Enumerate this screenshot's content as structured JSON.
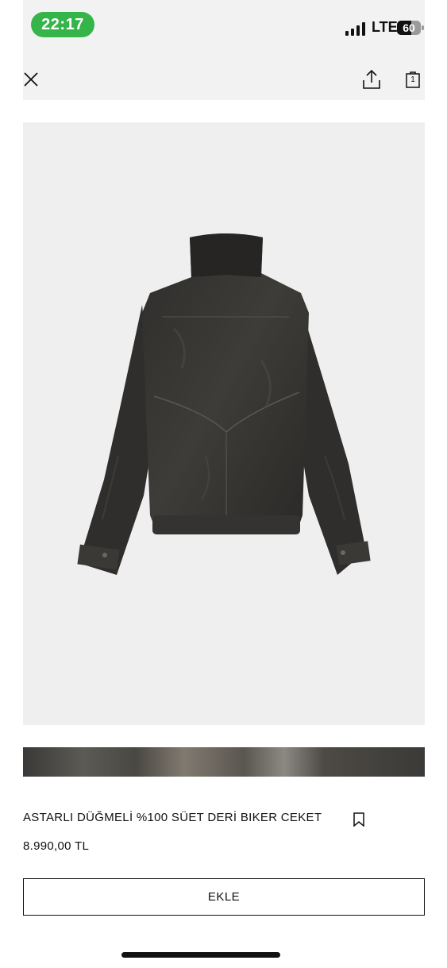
{
  "status_bar": {
    "time": "22:17",
    "network": "LTE",
    "battery_level": "60",
    "battery_fraction": 0.6
  },
  "nav": {
    "close_icon": "close-icon",
    "share_icon": "share-icon",
    "bag_icon": "shopping-bag-icon",
    "bag_count": "1"
  },
  "product": {
    "image_subject": "jacket-back-view",
    "title": "ASTARLI DÜĞMELİ %100 SÜET DERİ BIKER CEKET",
    "price": "8.990,00 TL",
    "bookmark_icon": "bookmark-icon"
  },
  "actions": {
    "add_label": "EKLE"
  },
  "colors": {
    "status_green": "#34b449",
    "image_background": "#efefef"
  }
}
